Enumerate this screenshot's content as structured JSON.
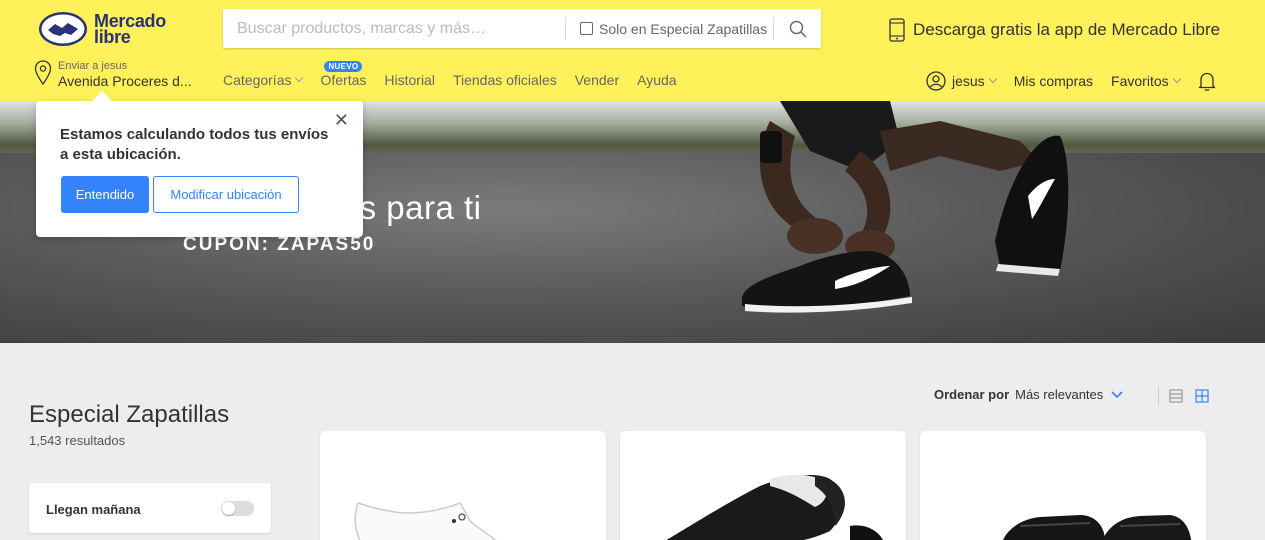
{
  "header": {
    "logo_line1": "mercado",
    "logo_line2": "libre",
    "search_placeholder": "Buscar productos, marcas y más…",
    "search_filter_label": "Solo en Especial Zapatillas",
    "app_promo": "Descarga gratis la app de Mercado Libre",
    "location_small": "Enviar a jesus",
    "location_big": "Avenida Proceres d...",
    "nav": [
      {
        "label": "Categorías"
      },
      {
        "label": "Ofertas",
        "badge": "NUEVO"
      },
      {
        "label": "Historial"
      },
      {
        "label": "Tiendas oficiales"
      },
      {
        "label": "Vender"
      },
      {
        "label": "Ayuda"
      }
    ],
    "user_name": "jesus",
    "my_purchases": "Mis compras",
    "favorites": "Favoritos"
  },
  "hero": {
    "title": "las perfectas para ti",
    "coupon": "CUPON: ZAPAS50"
  },
  "popup": {
    "message": "Estamos calculando todos tus envíos a esta ubicación.",
    "primary_button": "Entendido",
    "secondary_button": "Modificar ubicación",
    "close_symbol": "✕"
  },
  "listing": {
    "title": "Especial Zapatillas",
    "results": "1,543 resultados",
    "sort_label": "Ordenar por",
    "sort_value": "Más relevantes",
    "filter_label": "Llegan mañana",
    "filter_toggle_on": false
  },
  "colors": {
    "header_yellow": "#fff159",
    "accent_blue": "#3483fa",
    "logo_navy": "#2d3277"
  }
}
